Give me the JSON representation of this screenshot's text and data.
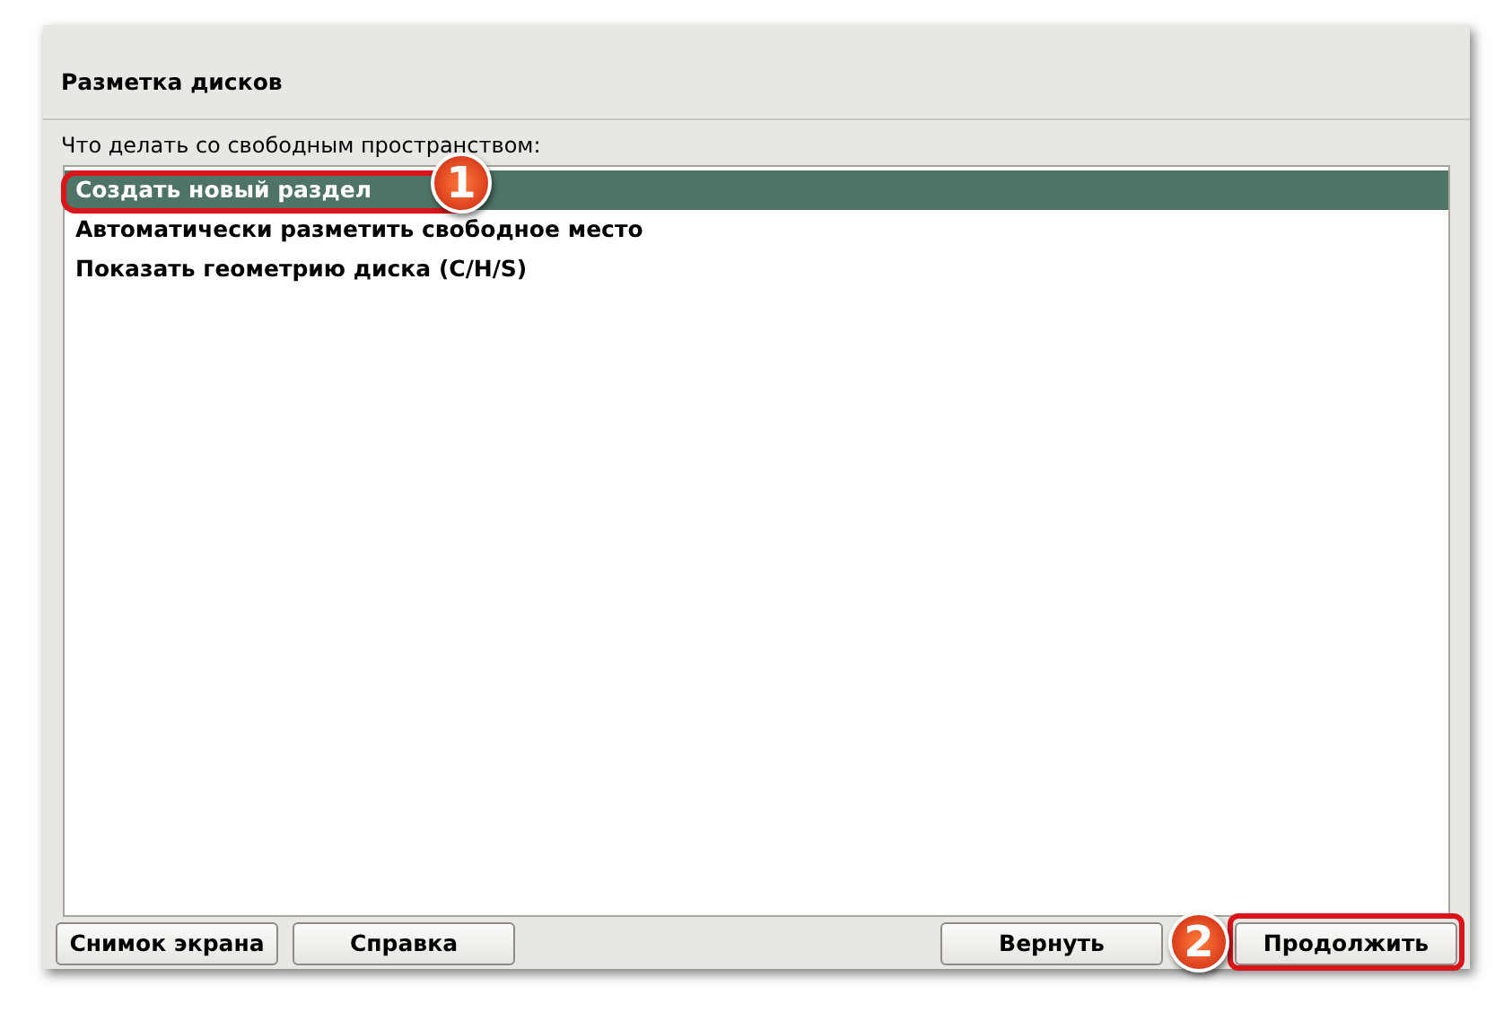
{
  "dialog": {
    "title": "Разметка дисков",
    "prompt": "Что делать со свободным пространством:",
    "options": [
      {
        "label": "Создать новый раздел",
        "selected": true,
        "highlighted": true,
        "callout": "1"
      },
      {
        "label": "Автоматически разметить свободное место",
        "selected": false,
        "highlighted": false
      },
      {
        "label": "Показать геометрию диска (C/H/S)",
        "selected": false,
        "highlighted": false
      }
    ],
    "left_buttons": [
      {
        "label": "Снимок экрана",
        "highlighted": false
      },
      {
        "label": "Справка",
        "highlighted": false
      }
    ],
    "right_buttons": [
      {
        "label": "Вернуть",
        "highlighted": false
      },
      {
        "label": "Продолжить",
        "highlighted": true,
        "callout": "2"
      }
    ]
  }
}
